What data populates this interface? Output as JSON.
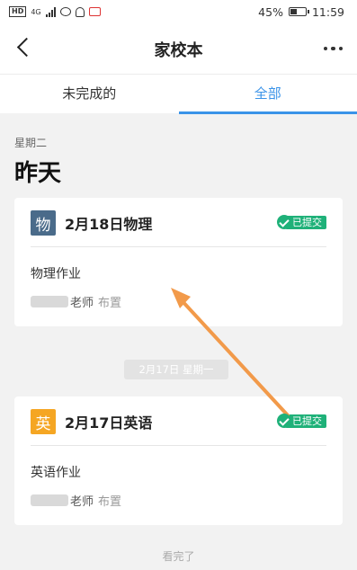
{
  "status_bar": {
    "hd": "HD",
    "network": "4G",
    "battery": "45%",
    "time": "11:59"
  },
  "navbar": {
    "title": "家校本"
  },
  "tabs": [
    {
      "label": "未完成的",
      "active": false
    },
    {
      "label": "全部",
      "active": true
    }
  ],
  "section": {
    "weekday": "星期二",
    "day": "昨天"
  },
  "cards": [
    {
      "subject_char": "物",
      "title": "2月18日物理",
      "status": "已提交",
      "homework": "物理作业",
      "teacher": "老师",
      "assigned": "布置"
    },
    {
      "subject_char": "英",
      "title": "2月17日英语",
      "status": "已提交",
      "homework": "英语作业",
      "teacher": "老师",
      "assigned": "布置"
    }
  ],
  "date_separator": "2月17日 星期一",
  "end_text": "看完了",
  "colors": {
    "accent": "#3a93e8",
    "submitted": "#1fb179",
    "physics": "#4a6b8a",
    "english": "#f5a623",
    "annotation_arrow": "#f29a4a"
  }
}
